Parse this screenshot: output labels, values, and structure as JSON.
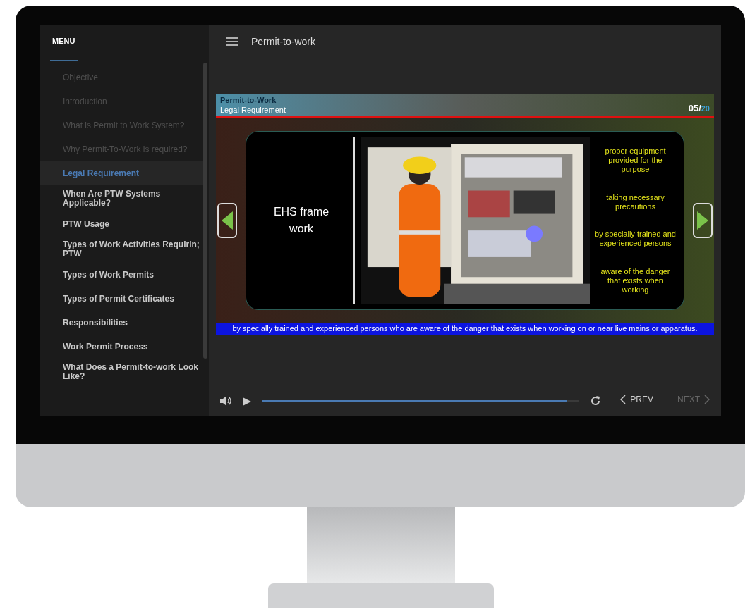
{
  "sidebar": {
    "title": "MENU",
    "items": [
      {
        "label": "Objective",
        "visited": true,
        "selected": false
      },
      {
        "label": "Introduction",
        "visited": true,
        "selected": false
      },
      {
        "label": "What is Permit to Work System?",
        "visited": true,
        "selected": false
      },
      {
        "label": "Why Permit-To-Work is required?",
        "visited": true,
        "selected": false
      },
      {
        "label": "Legal Requirement",
        "visited": false,
        "selected": true
      },
      {
        "label": "When Are PTW Systems Applicable?",
        "visited": false,
        "selected": false
      },
      {
        "label": "PTW Usage",
        "visited": false,
        "selected": false
      },
      {
        "label": "Types of Work Activities Requirin; PTW",
        "visited": false,
        "selected": false
      },
      {
        "label": "Types of Work Permits",
        "visited": false,
        "selected": false
      },
      {
        "label": "Types of Permit Certificates",
        "visited": false,
        "selected": false
      },
      {
        "label": "Responsibilities",
        "visited": false,
        "selected": false
      },
      {
        "label": "Work Permit Process",
        "visited": false,
        "selected": false
      },
      {
        "label": "What Does a Permit-to-work Look Like?",
        "visited": false,
        "selected": false
      }
    ]
  },
  "header": {
    "title": "Permit-to-work"
  },
  "slide": {
    "course": "Permit-to-Work",
    "topic": "Legal Requirement",
    "page": "05",
    "separator": "/",
    "total": "20",
    "frame_label": "EHS frame work",
    "points": [
      "proper equipment provided for the purpose",
      "taking necessary precautions",
      "by specially trained and experienced persons",
      "aware of the danger that exists when working"
    ],
    "caption": "by specially trained and experienced persons who are aware of the danger that exists when working on or near live mains or apparatus."
  },
  "controls": {
    "progress": {
      "level": 0.96
    },
    "prev": {
      "label": "PREV",
      "disabled": false
    },
    "next": {
      "label": "NEXT",
      "disabled": true
    }
  }
}
